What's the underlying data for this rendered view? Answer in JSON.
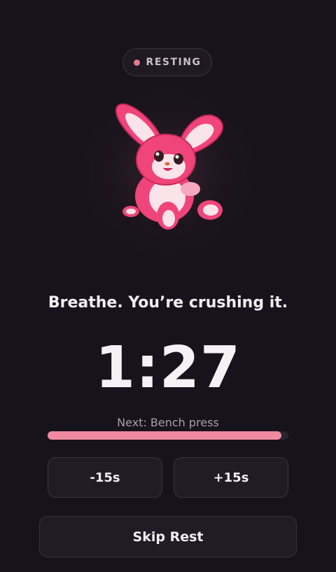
{
  "status": {
    "label": "RESTING",
    "dot_color": "#e07a8d"
  },
  "mascot": {
    "icon": "pink-bunny-mascot-icon"
  },
  "message": "Breathe. You’re crushing it.",
  "timer": {
    "display": "1:27"
  },
  "next": {
    "label": "Next: Bench press"
  },
  "progress": {
    "fraction": 0.97,
    "fill_color": "#f08aa0"
  },
  "controls": {
    "minus_label": "-15s",
    "plus_label": "+15s",
    "skip_label": "Skip Rest"
  },
  "colors": {
    "background": "#17131c",
    "accent": "#f08aa0",
    "button_bg": "#201b25"
  }
}
